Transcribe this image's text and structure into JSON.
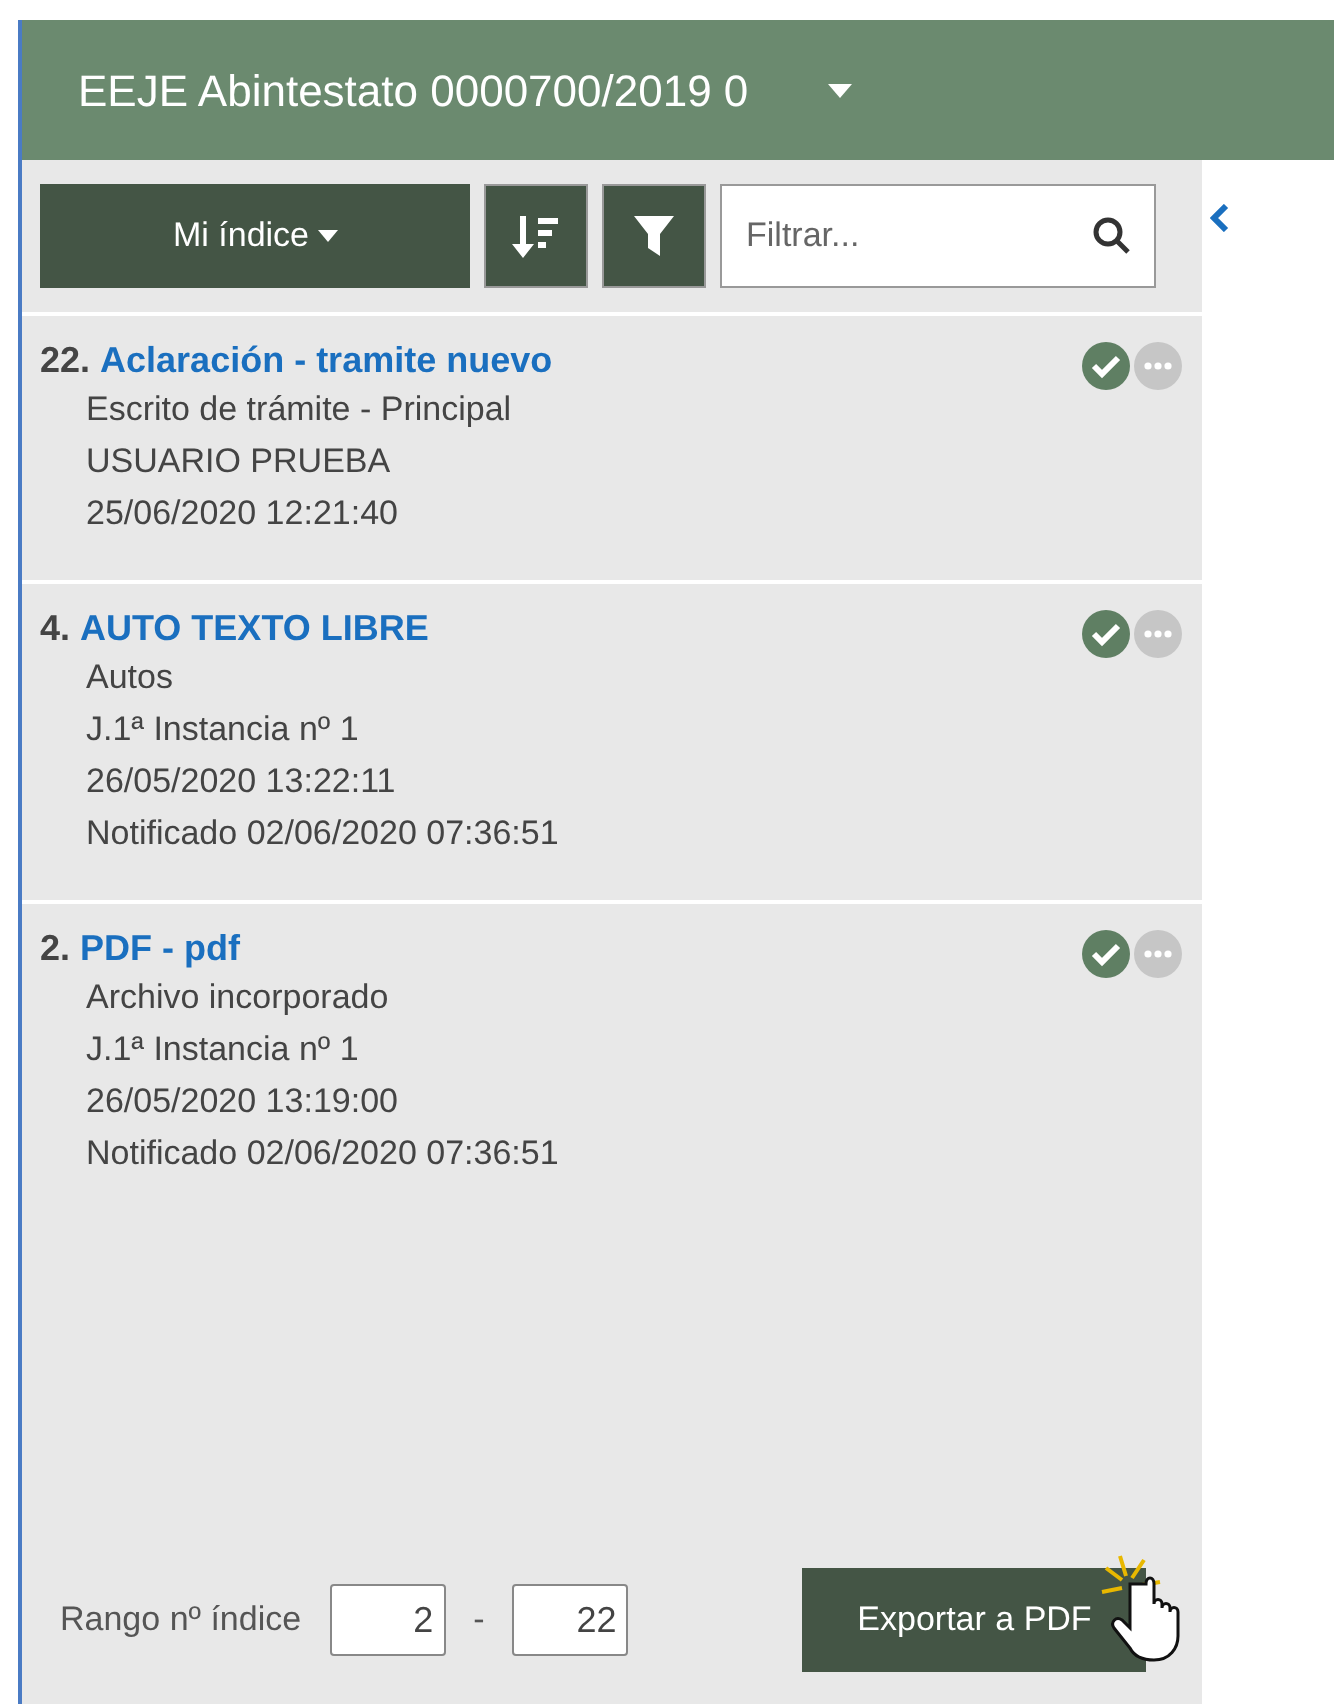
{
  "header": {
    "title": "EEJE Abintestato 0000700/2019 0"
  },
  "toolbar": {
    "index_button": "Mi índice",
    "filter": {
      "placeholder": "Filtrar..."
    }
  },
  "items": [
    {
      "number": "22.",
      "title": "Aclaración - tramite nuevo",
      "lines": [
        "Escrito de trámite - Principal",
        "USUARIO PRUEBA",
        "25/06/2020 12:21:40"
      ],
      "signed": true
    },
    {
      "number": "4.",
      "title": "AUTO TEXTO LIBRE",
      "lines": [
        "Autos",
        "J.1ª Instancia nº 1",
        "26/05/2020 13:22:11",
        "Notificado 02/06/2020 07:36:51"
      ],
      "signed": true
    },
    {
      "number": "2.",
      "title": "PDF - pdf",
      "lines": [
        "Archivo incorporado",
        "J.1ª Instancia nº 1",
        "26/05/2020 13:19:00",
        "Notificado 02/06/2020 07:36:51"
      ],
      "signed": true
    }
  ],
  "footer": {
    "range_label": "Rango nº índice",
    "from": "2",
    "separator": "-",
    "to": "22",
    "export_button": "Exportar a PDF"
  }
}
